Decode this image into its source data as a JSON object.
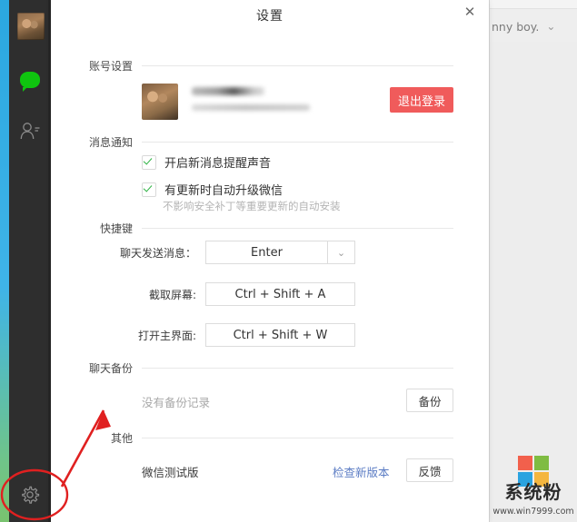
{
  "dialog": {
    "title": "设置",
    "close_label": "✕"
  },
  "sidebar": {
    "items": [
      {
        "name": "avatar",
        "label": ""
      },
      {
        "name": "chat",
        "label": ""
      },
      {
        "name": "contacts",
        "label": ""
      },
      {
        "name": "settings",
        "label": ""
      }
    ]
  },
  "background_window": {
    "contact_name": "nny boy.",
    "chevron": "⌄"
  },
  "sections": {
    "account": {
      "label": "账号设置",
      "logout_button": "退出登录"
    },
    "notification": {
      "label": "消息通知",
      "checkboxes": [
        {
          "label": "开启新消息提醒声音",
          "checked": true,
          "hint": ""
        },
        {
          "label": "有更新时自动升级微信",
          "checked": true,
          "hint": "不影响安全补丁等重要更新的自动安装"
        }
      ]
    },
    "shortcuts": {
      "label": "快捷键",
      "rows": [
        {
          "label": "聊天发送消息：",
          "value": "Enter",
          "has_dropdown": true,
          "chevron": "⌄"
        },
        {
          "label": "截取屏幕:",
          "value": "Ctrl + Shift + A",
          "has_dropdown": false
        },
        {
          "label": "打开主界面:",
          "value": "Ctrl + Shift + W",
          "has_dropdown": false
        }
      ]
    },
    "backup": {
      "label": "聊天备份",
      "status_text": "没有备份记录",
      "backup_button": "备份"
    },
    "other": {
      "label": "其他",
      "version_text": "微信测试版",
      "check_update_link": "检查新版本",
      "feedback_button": "反馈"
    }
  },
  "watermark": {
    "brand": "系统粉",
    "url": "www.win7999.com",
    "tile_colors": [
      "#f2604c",
      "#7fbc42",
      "#2aa3e0",
      "#f4b63f"
    ]
  },
  "colors": {
    "accent_red": "#f05b5b",
    "link_blue": "#5b7cc4",
    "check_green": "#2fb344",
    "annotation_red": "#e02020",
    "sidebar_dark": "#2e2e2e"
  }
}
